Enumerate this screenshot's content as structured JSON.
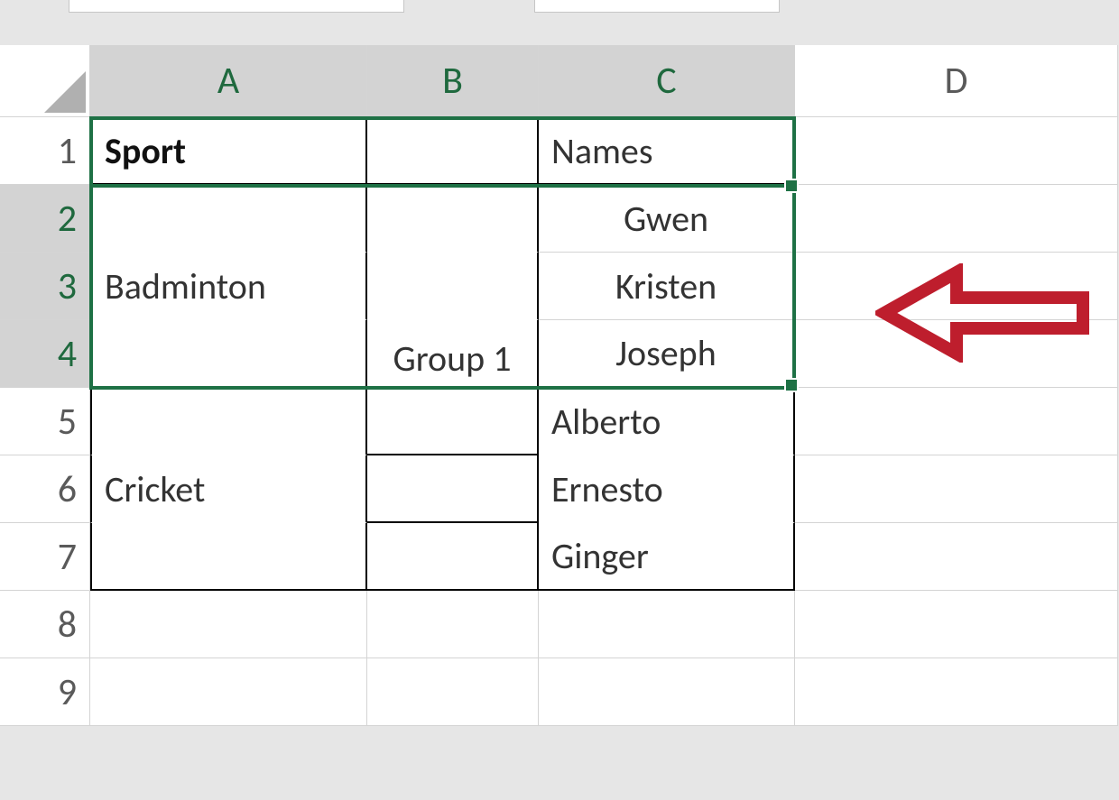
{
  "columns": {
    "A": "A",
    "B": "B",
    "C": "C",
    "D": "D"
  },
  "rows": [
    "1",
    "2",
    "3",
    "4",
    "5",
    "6",
    "7",
    "8",
    "9"
  ],
  "header": {
    "sport_label": "Sport",
    "names_label": "Names"
  },
  "sports": {
    "badminton": "Badminton",
    "cricket": "Cricket"
  },
  "group": {
    "label": "Group 1"
  },
  "names": {
    "r2": "Gwen",
    "r3": "Kristen",
    "r4": "Joseph",
    "r5": "Alberto",
    "r6": "Ernesto",
    "r7": "Ginger"
  },
  "selection": {
    "range": "A2:C4",
    "active_cell": "A2"
  },
  "colors": {
    "selection_border": "#1e7145",
    "arrow": "#be1e2d",
    "header_fill": "#e8e4ee"
  }
}
